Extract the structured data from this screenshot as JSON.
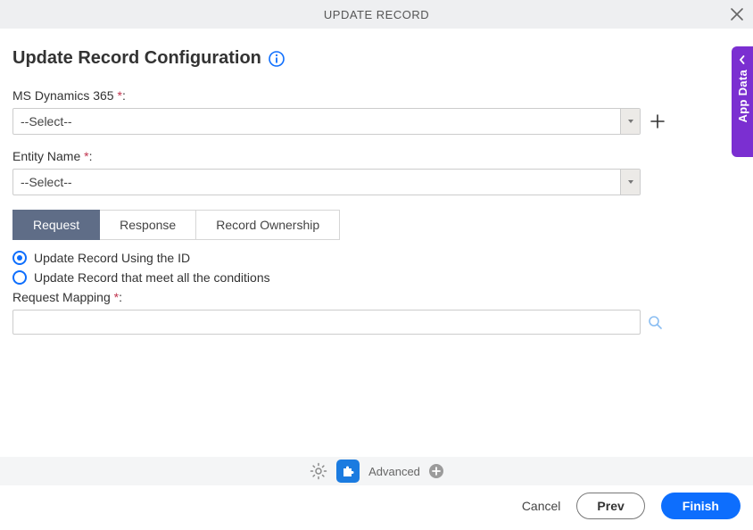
{
  "header": {
    "title": "UPDATE RECORD"
  },
  "config": {
    "heading": "Update Record Configuration",
    "fields": {
      "dynamics_label": "MS Dynamics 365 ",
      "dynamics_suffix": ":",
      "dynamics_value": "--Select--",
      "entity_label": "Entity Name ",
      "entity_suffix": ":",
      "entity_value": "--Select--"
    },
    "required_mark": "*",
    "tabs": [
      "Request",
      "Response",
      "Record Ownership"
    ],
    "radios": {
      "opt1": "Update Record Using the ID",
      "opt2": "Update Record that meet all the conditions"
    },
    "mapping_label": "Request Mapping ",
    "mapping_suffix": ":"
  },
  "sidebar": {
    "label": "App Data"
  },
  "footer": {
    "advanced_label": "Advanced"
  },
  "buttons": {
    "cancel": "Cancel",
    "prev": "Prev",
    "finish": "Finish"
  }
}
